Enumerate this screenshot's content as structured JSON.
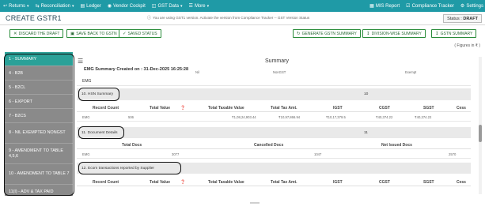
{
  "nav": {
    "items": [
      {
        "icon": "return",
        "label": "Returns",
        "caret": true
      },
      {
        "icon": "reconcile",
        "label": "Reconciliation",
        "caret": true
      },
      {
        "icon": "ledger",
        "label": "Ledger",
        "caret": false
      },
      {
        "icon": "vendor",
        "label": "Vendor Cockpit",
        "caret": false
      },
      {
        "icon": "gst",
        "label": "GST Data",
        "caret": true
      },
      {
        "icon": "more",
        "label": "More",
        "caret": true
      }
    ],
    "right_items": [
      {
        "icon": "report",
        "label": "MIS Report"
      },
      {
        "icon": "compliance",
        "label": "Compliance Tracker"
      },
      {
        "icon": "settings",
        "label": "Settings"
      }
    ]
  },
  "header": {
    "title": "CREATE GSTR1",
    "version_note": "You are using GST1 version. Activate the version from Compliance Tracker -- GST Version Status",
    "status_label": "Status :",
    "status_value": "DRAFT"
  },
  "actions": {
    "discard": "DISCARD THE DRAFT",
    "save_back": "SAVE BACK TO GSTN",
    "saved_status": "SAVED STATUS",
    "generate": "GENERATE GSTN SUMMARY",
    "division": "DIVISION-WISE SUMMARY",
    "gstn": "GSTN SUMMARY"
  },
  "figures_note": "( Figures in ₹ )",
  "sidebar": {
    "items": [
      {
        "label": "1 - SUMMARY",
        "active": true
      },
      {
        "label": "4 - B2B",
        "active": false
      },
      {
        "label": "5 - B2CL",
        "active": false
      },
      {
        "label": "6 - EXPORT",
        "active": false
      },
      {
        "label": "7 - B2CS",
        "active": false
      },
      {
        "label": "8 - NIL EXEMPTED NONGST",
        "active": false
      },
      {
        "label": "9 - AMENDMENT TO TABLE 4,5,6",
        "active": false
      },
      {
        "label": "10 - AMENDMENT TO TABLE 7",
        "active": false
      },
      {
        "label": "11(I) - ADV & TAX PAID",
        "active": false
      }
    ]
  },
  "main": {
    "heading": "Summary",
    "created_on": "EMG Summary Created on : 31-Dec-2025 16:25:28",
    "top_headers": {
      "nil": "Nil",
      "nongst": "NonGST",
      "exempt": "Exempt"
    },
    "top_row_label": "EMG",
    "hsn": {
      "title": "10. HSN Summary",
      "count": "10",
      "headers": [
        "Record Count",
        "Total Value",
        "Total Taxable Value",
        "Total Tax Amt.",
        "IGST",
        "CGST",
        "SGST",
        "Cess"
      ],
      "row": {
        "label": "EMG",
        "values": [
          "506",
          "",
          "₹1,08,24,903.44",
          "₹10,97,866.94",
          "₹10,17,379.5",
          "₹40,374.22",
          "₹40,374.22",
          ""
        ]
      }
    },
    "docs": {
      "title": "11. Document Details",
      "count": "11",
      "headers": [
        "Total Docs",
        "Cancelled Docs",
        "Net Issued Docs"
      ],
      "row": {
        "label": "EMG",
        "values": [
          "3077",
          "1047",
          "2570"
        ]
      }
    },
    "ecom": {
      "title": "12. Ecom transactions reported by Supplier",
      "count": "12",
      "headers": [
        "Record Count",
        "Total Value",
        "Total Taxable Value",
        "Total Tax Amt.",
        "IGST",
        "CGST",
        "SGST",
        "Cess"
      ]
    }
  }
}
